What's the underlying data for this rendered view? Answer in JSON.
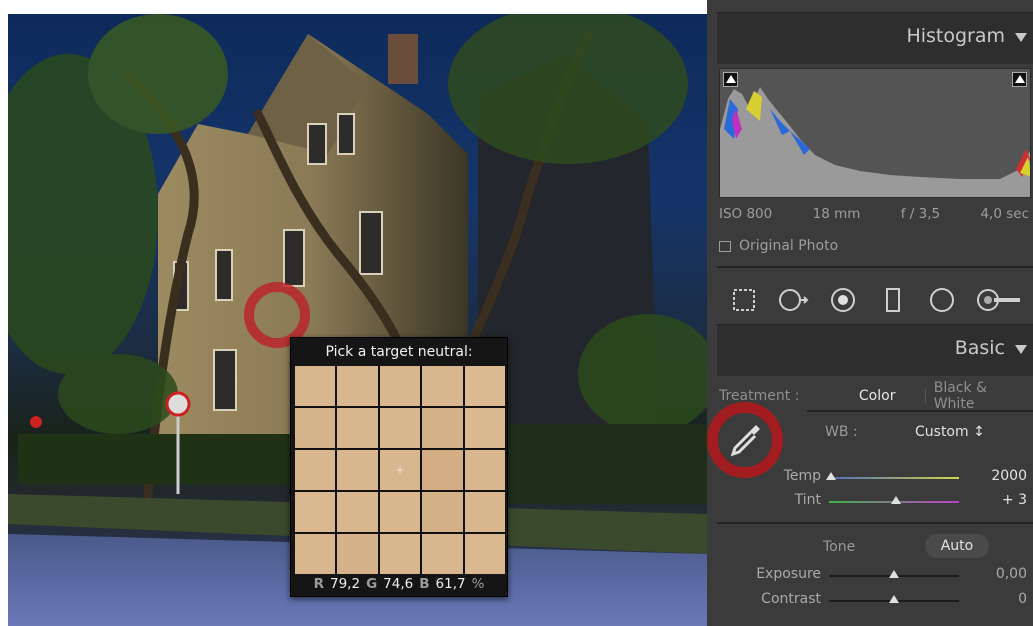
{
  "loupe": {
    "title": "Pick a target neutral:",
    "center_mark": "+",
    "r_label": "R",
    "r_value": "79,2",
    "g_label": "G",
    "g_value": "74,6",
    "b_label": "B",
    "b_value": "61,7",
    "pct": "%"
  },
  "histogram": {
    "title": "Histogram",
    "iso": "ISO 800",
    "focal": "18 mm",
    "aperture": "f / 3,5",
    "shutter": "4,0 sec",
    "original_photo": "Original Photo"
  },
  "tools": {
    "names": [
      "crop-icon",
      "spot-removal-icon",
      "red-eye-icon",
      "graduated-filter-icon",
      "radial-filter-icon",
      "adjustment-brush-icon"
    ]
  },
  "basic": {
    "title": "Basic",
    "treatment_label": "Treatment :",
    "color": "Color",
    "bw": "Black & White",
    "wb_label": "WB :",
    "wb_value": "Custom ↕",
    "temp_label": "Temp",
    "temp_value": "2000",
    "tint_label": "Tint",
    "tint_value": "+ 3",
    "tone_label": "Tone",
    "auto_label": "Auto",
    "exposure_label": "Exposure",
    "exposure_value": "0,00",
    "contrast_label": "Contrast",
    "contrast_value": "0"
  },
  "colors": {
    "panel_bg": "#3b3b3b",
    "header_bg": "#2e2e2e",
    "highlight_ring": "#be1e28",
    "sample_color": "#d8b68e"
  }
}
